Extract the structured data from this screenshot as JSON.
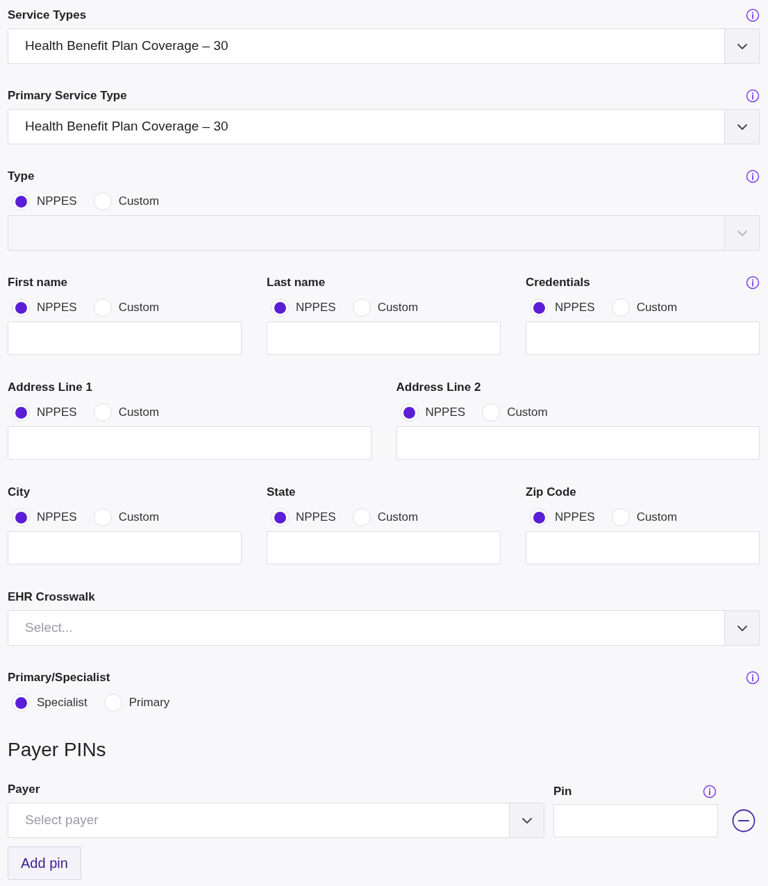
{
  "sections": [
    {
      "kind": "select",
      "label": "Service Types",
      "info": true,
      "value": "Health Benefit Plan Coverage – 30"
    },
    {
      "kind": "select",
      "label": "Primary Service Type",
      "info": true,
      "value": "Health Benefit Plan Coverage – 30"
    },
    {
      "kind": "radio_select",
      "label": "Type",
      "info": true,
      "disabled": true,
      "options": [
        {
          "label": "NPPES",
          "selected": true
        },
        {
          "label": "Custom",
          "selected": false
        }
      ]
    },
    {
      "kind": "field_row",
      "fields": [
        {
          "label": "First name",
          "info": false,
          "options": [
            {
              "label": "NPPES",
              "selected": true
            },
            {
              "label": "Custom",
              "selected": false
            }
          ]
        },
        {
          "label": "Last name",
          "info": false,
          "options": [
            {
              "label": "NPPES",
              "selected": true
            },
            {
              "label": "Custom",
              "selected": false
            }
          ]
        },
        {
          "label": "Credentials",
          "info": true,
          "options": [
            {
              "label": "NPPES",
              "selected": true
            },
            {
              "label": "Custom",
              "selected": false
            }
          ]
        }
      ]
    },
    {
      "kind": "field_row",
      "fields": [
        {
          "label": "Address Line 1",
          "info": false,
          "options": [
            {
              "label": "NPPES",
              "selected": true
            },
            {
              "label": "Custom",
              "selected": false
            }
          ]
        },
        {
          "label": "Address Line 2",
          "info": false,
          "options": [
            {
              "label": "NPPES",
              "selected": true
            },
            {
              "label": "Custom",
              "selected": false
            }
          ]
        }
      ]
    },
    {
      "kind": "field_row",
      "fields": [
        {
          "label": "City",
          "info": false,
          "options": [
            {
              "label": "NPPES",
              "selected": true
            },
            {
              "label": "Custom",
              "selected": false
            }
          ]
        },
        {
          "label": "State",
          "info": false,
          "options": [
            {
              "label": "NPPES",
              "selected": true
            },
            {
              "label": "Custom",
              "selected": false
            }
          ]
        },
        {
          "label": "Zip Code",
          "info": false,
          "options": [
            {
              "label": "NPPES",
              "selected": true
            },
            {
              "label": "Custom",
              "selected": false
            }
          ]
        }
      ]
    },
    {
      "kind": "select",
      "label": "EHR Crosswalk",
      "info": false,
      "placeholder": "Select..."
    },
    {
      "kind": "radio",
      "label": "Primary/Specialist",
      "info": true,
      "options": [
        {
          "label": "Specialist",
          "selected": true
        },
        {
          "label": "Primary",
          "selected": false
        }
      ]
    },
    {
      "kind": "heading",
      "text": "Payer PINs"
    },
    {
      "kind": "payer_row",
      "payer": {
        "label": "Payer",
        "placeholder": "Select payer"
      },
      "pin": {
        "label": "Pin",
        "info": true
      }
    },
    {
      "kind": "button",
      "label": "Add pin"
    }
  ]
}
